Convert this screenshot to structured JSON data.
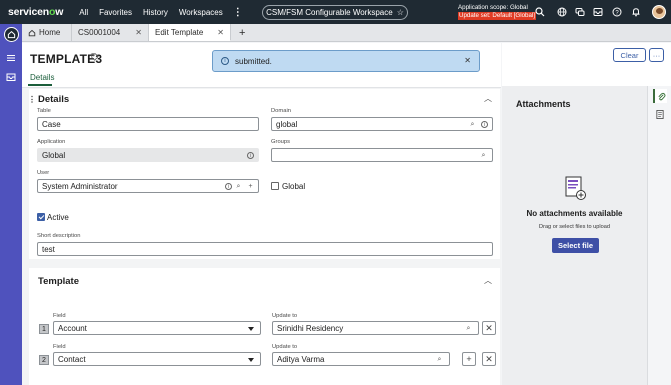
{
  "topnav": {
    "logo_prefix": "servicen",
    "logo_o": "o",
    "logo_suffix": "w",
    "items": [
      "All",
      "Favorites",
      "History",
      "Workspaces"
    ],
    "workspace": "CSM/FSM Configurable Workspace",
    "scope_line1": "Application scope: Global",
    "scope_line2": "Update set: Default [Global]"
  },
  "tabs": {
    "home": "Home",
    "case": "CS0001004",
    "active": "Edit Template",
    "add": "+"
  },
  "header": {
    "title": "TEMPLATE3",
    "subtab": "Details",
    "clear_label": "Clear",
    "more_label": "···"
  },
  "toast": {
    "message": "submitted."
  },
  "details": {
    "heading": "Details",
    "table_label": "Table",
    "table_value": "Case",
    "domain_label": "Domain",
    "domain_value": "global",
    "application_label": "Application",
    "application_value": "Global",
    "groups_label": "Groups",
    "groups_value": "",
    "user_label": "User",
    "user_value": "System Administrator",
    "global_label": "Global",
    "active_label": "Active",
    "short_desc_label": "Short description",
    "short_desc_value": "test"
  },
  "template": {
    "heading": "Template",
    "rows": [
      {
        "num": "1",
        "field_label": "Field",
        "field_value": "Account",
        "update_label": "Update to",
        "update_value": "Srinidhi Residency"
      },
      {
        "num": "2",
        "field_label": "Field",
        "field_value": "Contact",
        "update_label": "Update to",
        "update_value": "Aditya Varma"
      }
    ]
  },
  "attachments": {
    "title": "Attachments",
    "empty": "No attachments available",
    "hint": "Drag or select files to upload",
    "button": "Select file"
  },
  "colors": {
    "nav_bg": "#1f2a33",
    "rail_bg": "#4f52bd",
    "accent_green": "#62d84e",
    "primary_button": "#3e4fa6",
    "toast_bg": "#bfdaf2",
    "scope_warning": "#e03b24"
  }
}
